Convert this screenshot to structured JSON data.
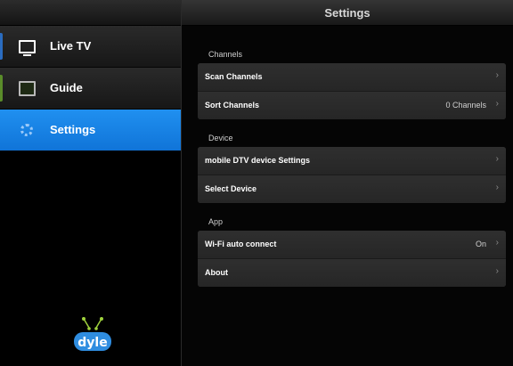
{
  "header": {
    "title": "Settings"
  },
  "sidebar": {
    "items": [
      {
        "label": "Live TV",
        "icon": "tv-icon",
        "active": false,
        "accent_color": "#2a6cc0"
      },
      {
        "label": "Guide",
        "icon": "guide-icon",
        "active": false,
        "accent_color": "#5a8c2a"
      },
      {
        "label": "Settings",
        "icon": "gear-icon",
        "active": true,
        "accent_color": "#1a6acf"
      }
    ],
    "logo_text": "dyle"
  },
  "sections": [
    {
      "title": "Channels",
      "rows": [
        {
          "label": "Scan Channels",
          "value": "",
          "icon": "chevron-right-icon"
        },
        {
          "label": "Sort Channels",
          "value": "0 Channels",
          "icon": "chevron-right-icon"
        }
      ]
    },
    {
      "title": "Device",
      "rows": [
        {
          "label": "mobile DTV device Settings",
          "value": "",
          "icon": "chevron-right-icon"
        },
        {
          "label": "Select Device",
          "value": "",
          "icon": "chevron-right-icon"
        }
      ]
    },
    {
      "title": "App",
      "rows": [
        {
          "label": "Wi-Fi auto connect",
          "value": "On",
          "icon": "chevron-right-icon"
        },
        {
          "label": "About",
          "value": "",
          "icon": "chevron-right-icon"
        }
      ]
    }
  ],
  "colors": {
    "active_nav": "#1a82e6",
    "row_bg": "#2b2b2b",
    "background": "#050505"
  }
}
